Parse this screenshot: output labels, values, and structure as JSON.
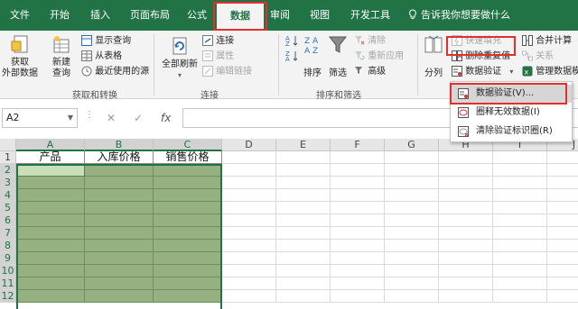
{
  "tabs": [
    {
      "label": "文件",
      "active": false
    },
    {
      "label": "开始",
      "active": false
    },
    {
      "label": "插入",
      "active": false
    },
    {
      "label": "页面布局",
      "active": false
    },
    {
      "label": "公式",
      "active": false
    },
    {
      "label": "数据",
      "active": true
    },
    {
      "label": "审阅",
      "active": false
    },
    {
      "label": "视图",
      "active": false
    },
    {
      "label": "开发工具",
      "active": false
    }
  ],
  "tell_me": "告诉我你想要做什么",
  "ribbon": {
    "get_external": {
      "line1": "获取",
      "line2": "外部数据"
    },
    "new_query": {
      "line1": "新建",
      "line2": "查询"
    },
    "show_queries": "显示查询",
    "from_table": "从表格",
    "recent_sources": "最近使用的源",
    "group_get_transform": "获取和转换",
    "refresh_all": "全部刷新",
    "connections": "连接",
    "properties": "属性",
    "edit_links": "编辑链接",
    "group_connections": "连接",
    "sort": "排序",
    "filter": "筛选",
    "clear": "清除",
    "reapply": "重新应用",
    "advanced": "高级",
    "group_sort_filter": "排序和筛选",
    "text_to_columns": "分列",
    "flash_fill": "快速填充",
    "remove_duplicates": "删除重复值",
    "data_validation": "数据验证",
    "consolidate": "合并计算",
    "relationships": "关系",
    "manage_data_model": "管理数据模"
  },
  "dropdown": {
    "items": [
      {
        "label": "数据验证(V)...",
        "highlighted": true
      },
      {
        "label": "圈释无效数据(I)",
        "highlighted": false
      },
      {
        "label": "清除验证标识圈(R)",
        "highlighted": false
      }
    ]
  },
  "formula_bar": {
    "name_box": "A2",
    "cancel_symbol": "✕",
    "enter_symbol": "✓",
    "fx_symbol": "fx",
    "value": ""
  },
  "sheet": {
    "columns": [
      "A",
      "B",
      "C",
      "D",
      "E",
      "F",
      "G",
      "H",
      "I",
      "J"
    ],
    "rows": [
      "1",
      "2",
      "3",
      "4",
      "5",
      "6",
      "7",
      "8",
      "9",
      "10",
      "11",
      "12"
    ],
    "headers": [
      "产品",
      "入库价格",
      "销售价格"
    ],
    "active_cell": "A2"
  },
  "colors": {
    "brand": "#217346",
    "highlight_border": "#e0302e",
    "shaded_cells": "#97b082"
  }
}
